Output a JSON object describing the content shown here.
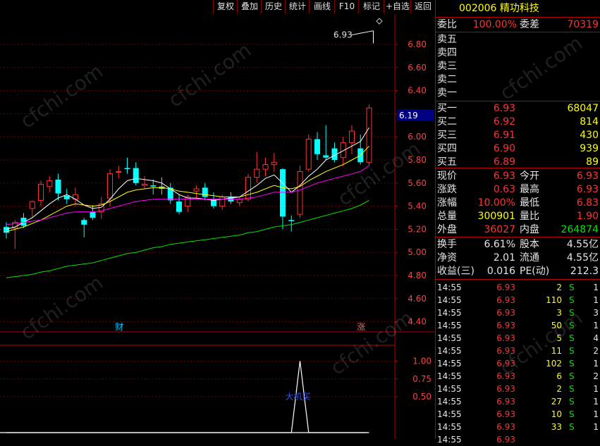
{
  "toolbar": {
    "buttons": [
      "复权",
      "叠加",
      "历史",
      "统计",
      "画线",
      "F10",
      "标记",
      "+自选",
      "返回"
    ]
  },
  "stock": {
    "code": "002006",
    "name": "精功科技"
  },
  "order_ratio": {
    "label_ratio": "委比",
    "ratio": "100.00%",
    "label_diff": "委差",
    "diff": "70319"
  },
  "asks": [
    {
      "label": "卖五",
      "price": "",
      "vol": ""
    },
    {
      "label": "卖四",
      "price": "",
      "vol": ""
    },
    {
      "label": "卖三",
      "price": "",
      "vol": ""
    },
    {
      "label": "卖二",
      "price": "",
      "vol": ""
    },
    {
      "label": "卖一",
      "price": "",
      "vol": ""
    }
  ],
  "bids": [
    {
      "label": "买一",
      "price": "6.93",
      "vol": "68047"
    },
    {
      "label": "买二",
      "price": "6.92",
      "vol": "814"
    },
    {
      "label": "买三",
      "price": "6.91",
      "vol": "430"
    },
    {
      "label": "买四",
      "price": "6.90",
      "vol": "939"
    },
    {
      "label": "买五",
      "price": "6.89",
      "vol": "89"
    }
  ],
  "quote": [
    {
      "l1": "现价",
      "v1": "6.93",
      "c1": "red",
      "l2": "今开",
      "v2": "6.93",
      "c2": "red"
    },
    {
      "l1": "涨跌",
      "v1": "0.63",
      "c1": "red",
      "l2": "最高",
      "v2": "6.93",
      "c2": "red"
    },
    {
      "l1": "涨幅",
      "v1": "10.00%",
      "c1": "red",
      "l2": "最低",
      "v2": "6.83",
      "c2": "red"
    },
    {
      "l1": "总量",
      "v1": "300901",
      "c1": "yel",
      "l2": "量比",
      "v2": "1.90",
      "c2": "red"
    },
    {
      "l1": "外盘",
      "v1": "36027",
      "c1": "red",
      "l2": "内盘",
      "v2": "264874",
      "c2": "grn"
    }
  ],
  "fundamentals": [
    {
      "l1": "换手",
      "v1": "6.61%",
      "l2": "股本",
      "v2": "4.55亿"
    },
    {
      "l1": "净资",
      "v1": "2.01",
      "l2": "流通",
      "v2": "4.55亿"
    },
    {
      "l1": "收益(三)",
      "v1": "0.016",
      "l2": "PE(动)",
      "v2": "212.3"
    }
  ],
  "trades": [
    {
      "time": "14:55",
      "price": "6.93",
      "vol": "2",
      "side": "S",
      "n": "1"
    },
    {
      "time": "14:55",
      "price": "6.93",
      "vol": "110",
      "side": "S",
      "n": "1"
    },
    {
      "time": "14:55",
      "price": "6.93",
      "vol": "3",
      "side": "S",
      "n": "3"
    },
    {
      "time": "14:55",
      "price": "6.93",
      "vol": "50",
      "side": "S",
      "n": "1"
    },
    {
      "time": "14:55",
      "price": "6.93",
      "vol": "5",
      "side": "S",
      "n": "4"
    },
    {
      "time": "14:55",
      "price": "6.93",
      "vol": "11",
      "side": "S",
      "n": "2"
    },
    {
      "time": "14:55",
      "price": "6.93",
      "vol": "102",
      "side": "S",
      "n": "1"
    },
    {
      "time": "14:55",
      "price": "6.93",
      "vol": "6",
      "side": "S",
      "n": "2"
    },
    {
      "time": "14:55",
      "price": "6.93",
      "vol": "2",
      "side": "S",
      "n": "1"
    },
    {
      "time": "14:55",
      "price": "6.93",
      "vol": "27",
      "side": "S",
      "n": "1"
    },
    {
      "time": "14:55",
      "price": "6.93",
      "vol": "10",
      "side": "S",
      "n": "1"
    },
    {
      "time": "14:55",
      "price": "6.93",
      "vol": "33",
      "side": "S",
      "n": "1"
    },
    {
      "time": "14:55",
      "price": "6.93",
      "vol": "",
      "side": "",
      "n": ""
    }
  ],
  "chart_data": [
    {
      "type": "candlestick",
      "title": "",
      "ylim": [
        4.3,
        6.98
      ],
      "yticks": [
        "6.80",
        "6.60",
        "6.40",
        "6.20",
        "6.00",
        "5.80",
        "5.60",
        "5.40",
        "5.20",
        "5.00",
        "4.80",
        "4.60",
        "4.40"
      ],
      "cursor_price": "6.19",
      "high_marker": "6.93",
      "event_labels": [
        {
          "text": "财",
          "index": 13
        },
        {
          "text": "涨",
          "index": 41
        }
      ],
      "candles": [
        {
          "o": 5.22,
          "h": 5.26,
          "l": 5.12,
          "c": 5.17
        },
        {
          "o": 5.21,
          "h": 5.28,
          "l": 5.03,
          "c": 5.26
        },
        {
          "o": 5.3,
          "h": 5.34,
          "l": 5.21,
          "c": 5.23
        },
        {
          "o": 5.38,
          "h": 5.45,
          "l": 5.3,
          "c": 5.44
        },
        {
          "o": 5.45,
          "h": 5.62,
          "l": 5.4,
          "c": 5.59
        },
        {
          "o": 5.57,
          "h": 5.66,
          "l": 5.52,
          "c": 5.62
        },
        {
          "o": 5.63,
          "h": 5.68,
          "l": 5.45,
          "c": 5.51
        },
        {
          "o": 5.49,
          "h": 5.55,
          "l": 5.42,
          "c": 5.46
        },
        {
          "o": 5.46,
          "h": 5.56,
          "l": 5.4,
          "c": 5.5
        },
        {
          "o": 5.28,
          "h": 5.3,
          "l": 5.13,
          "c": 5.24
        },
        {
          "o": 5.35,
          "h": 5.41,
          "l": 5.28,
          "c": 5.3
        },
        {
          "o": 5.35,
          "h": 5.48,
          "l": 5.29,
          "c": 5.42
        },
        {
          "o": 5.47,
          "h": 5.72,
          "l": 5.4,
          "c": 5.68
        },
        {
          "o": 5.7,
          "h": 5.75,
          "l": 5.64,
          "c": 5.7
        },
        {
          "o": 5.73,
          "h": 5.82,
          "l": 5.68,
          "c": 5.72
        },
        {
          "o": 5.73,
          "h": 5.78,
          "l": 5.58,
          "c": 5.6
        },
        {
          "o": 5.58,
          "h": 5.66,
          "l": 5.55,
          "c": 5.59
        },
        {
          "o": 5.58,
          "h": 5.63,
          "l": 5.5,
          "c": 5.57
        },
        {
          "o": 5.57,
          "h": 5.65,
          "l": 5.5,
          "c": 5.55
        },
        {
          "o": 5.56,
          "h": 5.6,
          "l": 5.42,
          "c": 5.45
        },
        {
          "o": 5.44,
          "h": 5.5,
          "l": 5.33,
          "c": 5.35
        },
        {
          "o": 5.4,
          "h": 5.5,
          "l": 5.35,
          "c": 5.48
        },
        {
          "o": 5.53,
          "h": 5.58,
          "l": 5.47,
          "c": 5.55
        },
        {
          "o": 5.56,
          "h": 5.6,
          "l": 5.45,
          "c": 5.48
        },
        {
          "o": 5.46,
          "h": 5.52,
          "l": 5.38,
          "c": 5.4
        },
        {
          "o": 5.4,
          "h": 5.5,
          "l": 5.37,
          "c": 5.48
        },
        {
          "o": 5.48,
          "h": 5.52,
          "l": 5.42,
          "c": 5.44
        },
        {
          "o": 5.43,
          "h": 5.48,
          "l": 5.4,
          "c": 5.46
        },
        {
          "o": 5.46,
          "h": 5.68,
          "l": 5.44,
          "c": 5.65
        },
        {
          "o": 5.65,
          "h": 5.87,
          "l": 5.6,
          "c": 5.72
        },
        {
          "o": 5.72,
          "h": 5.82,
          "l": 5.66,
          "c": 5.76
        },
        {
          "o": 5.76,
          "h": 5.86,
          "l": 5.7,
          "c": 5.78
        },
        {
          "o": 5.72,
          "h": 5.73,
          "l": 5.2,
          "c": 5.31
        },
        {
          "o": 5.28,
          "h": 5.32,
          "l": 5.18,
          "c": 5.27
        },
        {
          "o": 5.33,
          "h": 5.75,
          "l": 5.3,
          "c": 5.7
        },
        {
          "o": 5.72,
          "h": 6.02,
          "l": 5.7,
          "c": 5.98
        },
        {
          "o": 5.98,
          "h": 6.04,
          "l": 5.8,
          "c": 5.85
        },
        {
          "o": 5.84,
          "h": 6.1,
          "l": 5.8,
          "c": 5.82
        },
        {
          "o": 5.9,
          "h": 5.95,
          "l": 5.78,
          "c": 5.8
        },
        {
          "o": 5.82,
          "h": 6.0,
          "l": 5.75,
          "c": 5.95
        },
        {
          "o": 5.95,
          "h": 6.1,
          "l": 5.85,
          "c": 6.05
        },
        {
          "o": 5.9,
          "h": 6.02,
          "l": 5.76,
          "c": 5.78
        },
        {
          "o": 5.78,
          "h": 6.28,
          "l": 5.75,
          "c": 6.25
        }
      ],
      "ma_series": [
        {
          "color": "#ffffff",
          "values": [
            5.2,
            5.22,
            5.26,
            5.3,
            5.36,
            5.42,
            5.47,
            5.5,
            5.46,
            5.41,
            5.38,
            5.39,
            5.46,
            5.55,
            5.62,
            5.64,
            5.63,
            5.62,
            5.6,
            5.55,
            5.5,
            5.47,
            5.47,
            5.46,
            5.45,
            5.46,
            5.47,
            5.48,
            5.53,
            5.58,
            5.64,
            5.67,
            5.6,
            5.52,
            5.58,
            5.66,
            5.72,
            5.8,
            5.84,
            5.88,
            5.92,
            5.96,
            6.08
          ]
        },
        {
          "color": "#ffff00",
          "values": [
            5.18,
            5.2,
            5.22,
            5.25,
            5.28,
            5.32,
            5.36,
            5.4,
            5.42,
            5.41,
            5.4,
            5.41,
            5.44,
            5.48,
            5.52,
            5.54,
            5.55,
            5.56,
            5.56,
            5.55,
            5.53,
            5.52,
            5.51,
            5.5,
            5.49,
            5.48,
            5.48,
            5.48,
            5.5,
            5.52,
            5.55,
            5.58,
            5.56,
            5.55,
            5.57,
            5.62,
            5.66,
            5.7,
            5.73,
            5.76,
            5.8,
            5.84,
            5.92
          ]
        },
        {
          "color": "#ff00ff",
          "values": [
            5.24,
            5.25,
            5.26,
            5.27,
            5.28,
            5.3,
            5.32,
            5.34,
            5.35,
            5.35,
            5.35,
            5.36,
            5.38,
            5.4,
            5.42,
            5.44,
            5.45,
            5.46,
            5.46,
            5.46,
            5.46,
            5.46,
            5.46,
            5.46,
            5.46,
            5.46,
            5.46,
            5.46,
            5.47,
            5.48,
            5.5,
            5.52,
            5.52,
            5.52,
            5.54,
            5.57,
            5.6,
            5.62,
            5.64,
            5.66,
            5.68,
            5.7,
            5.75
          ]
        },
        {
          "color": "#00e600",
          "values": [
            4.78,
            4.79,
            4.8,
            4.81,
            4.83,
            4.84,
            4.86,
            4.88,
            4.89,
            4.9,
            4.91,
            4.93,
            4.95,
            4.97,
            4.99,
            5.0,
            5.02,
            5.04,
            5.05,
            5.07,
            5.08,
            5.09,
            5.1,
            5.11,
            5.12,
            5.13,
            5.14,
            5.15,
            5.17,
            5.18,
            5.2,
            5.22,
            5.23,
            5.24,
            5.26,
            5.28,
            5.3,
            5.32,
            5.34,
            5.36,
            5.38,
            5.41,
            5.45
          ]
        }
      ]
    },
    {
      "type": "line",
      "title": "",
      "ylim": [
        0,
        1.2
      ],
      "yticks": [
        "1.00",
        "0.75",
        "0.50"
      ],
      "values": [
        0,
        0,
        0,
        0,
        0,
        0,
        0,
        0,
        0,
        0,
        0,
        0,
        0,
        0,
        0,
        0,
        0,
        0,
        0,
        0,
        0,
        0,
        0,
        0,
        0,
        0,
        0,
        0,
        0,
        0,
        0,
        0,
        0,
        0,
        1,
        0,
        0,
        0,
        0,
        0,
        0,
        0,
        0
      ],
      "annotation": "大机买"
    }
  ]
}
